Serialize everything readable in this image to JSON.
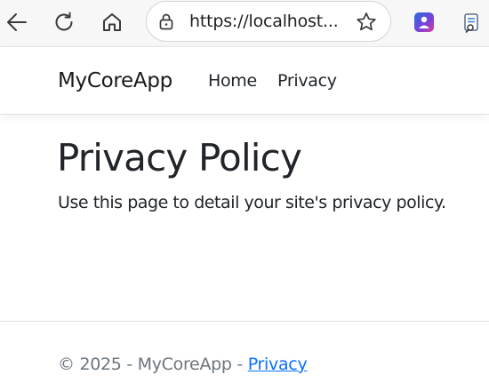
{
  "browser": {
    "url": "https://localhost...",
    "icons": {
      "back": "arrow-left-icon",
      "refresh": "refresh-icon",
      "home": "home-icon",
      "lock": "lock-icon",
      "favorite": "star-icon"
    }
  },
  "navbar": {
    "brand": "MyCoreApp",
    "links": [
      "Home",
      "Privacy"
    ]
  },
  "main": {
    "title": "Privacy Policy",
    "description": "Use this page to detail your site's privacy policy."
  },
  "footer": {
    "copyright": "© 2025 - MyCoreApp - ",
    "link_label": "Privacy"
  },
  "colors": {
    "link": "#0d6efd",
    "text": "#212529",
    "muted": "#6c757d"
  }
}
